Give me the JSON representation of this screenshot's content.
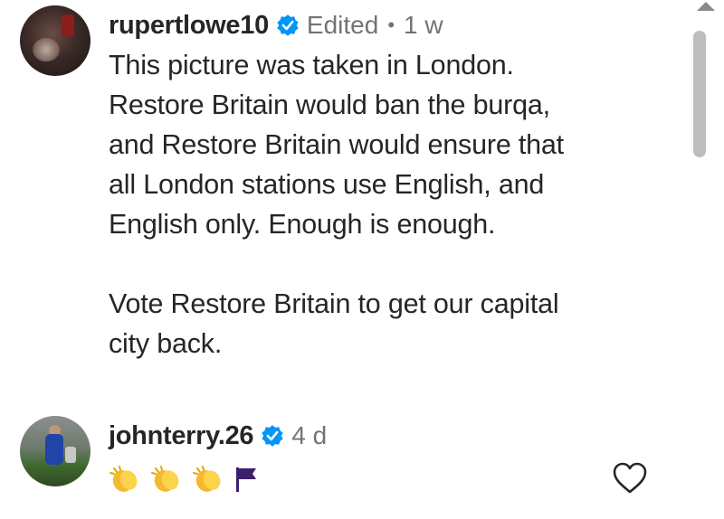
{
  "comments": [
    {
      "username": "rupertlowe10",
      "edited_label": "Edited",
      "separator": "•",
      "time": "1 w",
      "lines": [
        "This picture was taken in London.",
        "Restore Britain would ban the burqa,",
        "and Restore Britain would ensure that",
        "all London stations use English, and",
        "English only. Enough is enough.",
        "",
        "Vote Restore Britain to get our capital",
        "city back."
      ]
    },
    {
      "username": "johnterry.26",
      "time": "4 d",
      "emoji_icons": [
        "clapping-hands-icon",
        "clapping-hands-icon",
        "clapping-hands-icon",
        "purple-flag-icon"
      ]
    }
  ],
  "colors": {
    "verified_badge": "#0095f6",
    "username": "#262626",
    "meta": "#737373",
    "flag": "#3b1f6b",
    "clap": "#f5b82e"
  }
}
